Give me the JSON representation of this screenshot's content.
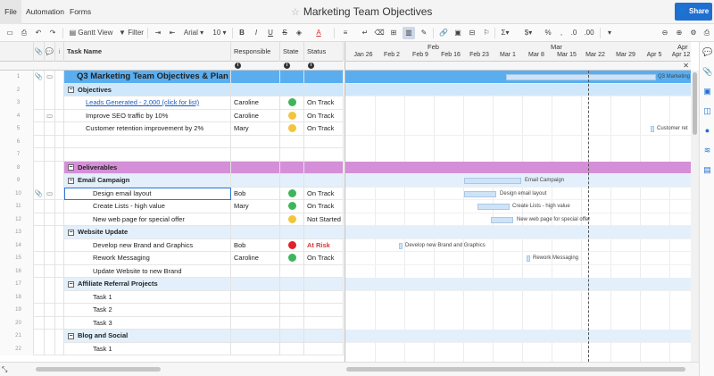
{
  "menu": {
    "file": "File",
    "automation": "Automation",
    "forms": "Forms"
  },
  "title": "Marketing Team Objectives",
  "share_label": "Share",
  "toolbar": {
    "view_label": "Gantt View",
    "filter_label": "Filter",
    "font": "Arial",
    "font_size": "10",
    "bold": "B",
    "italic": "I",
    "underline": "U",
    "strike": "S",
    "text_color": "A",
    "currency": "$",
    "percent": "%",
    "comma": ",",
    "decimal_less": ".0",
    "decimal_more": ".00",
    "sum": "Σ"
  },
  "columns": {
    "task": "Task Name",
    "responsible": "Responsible",
    "state": "State",
    "status": "Status"
  },
  "gantt": {
    "months": [
      "Feb",
      "Mar",
      "Apr"
    ],
    "weeks": [
      "Jan 26",
      "Feb 2",
      "Feb 9",
      "Feb 16",
      "Feb 23",
      "Mar 1",
      "Mar 8",
      "Mar 15",
      "Mar 22",
      "Mar 29",
      "Apr 5",
      "Apr 12"
    ],
    "bar_labels": {
      "row1": "Q3 Marketing",
      "row5": "Customer ret",
      "row9": "Email Campaign",
      "row10": "Design email layout",
      "row11": "Create Lists - high value",
      "row12": "New web page for special offer",
      "row14": "Develop new Brand and Graphics",
      "row15": "Rework Messaging"
    }
  },
  "rows": [
    {
      "num": "1",
      "task": "Q3 Marketing Team Objectives & Plan",
      "responsible": "",
      "status": ""
    },
    {
      "num": "2",
      "task": "Objectives",
      "responsible": "",
      "status": ""
    },
    {
      "num": "3",
      "task": "Leads Generated - 2,000 (click for list)",
      "responsible": "Caroline",
      "status": "On Track"
    },
    {
      "num": "4",
      "task": "Improve SEO traffic by 10%",
      "responsible": "Caroline",
      "status": "On Track"
    },
    {
      "num": "5",
      "task": "Customer retention improvement by 2%",
      "responsible": "Mary",
      "status": "On Track"
    },
    {
      "num": "6",
      "task": "",
      "responsible": "",
      "status": ""
    },
    {
      "num": "7",
      "task": "",
      "responsible": "",
      "status": ""
    },
    {
      "num": "8",
      "task": "Deliverables",
      "responsible": "",
      "status": ""
    },
    {
      "num": "9",
      "task": "Email Campaign",
      "responsible": "",
      "status": ""
    },
    {
      "num": "10",
      "task": "Design email layout",
      "responsible": "Bob",
      "status": "On Track"
    },
    {
      "num": "11",
      "task": "Create Lists - high value",
      "responsible": "Mary",
      "status": "On Track"
    },
    {
      "num": "12",
      "task": "New web page for special offer",
      "responsible": "",
      "status": "Not Started"
    },
    {
      "num": "13",
      "task": "Website Update",
      "responsible": "",
      "status": ""
    },
    {
      "num": "14",
      "task": "Develop new Brand and Graphics",
      "responsible": "Bob",
      "status": "At Risk"
    },
    {
      "num": "15",
      "task": "Rework Messaging",
      "responsible": "Caroline",
      "status": "On Track"
    },
    {
      "num": "16",
      "task": "Update Website to new Brand",
      "responsible": "",
      "status": ""
    },
    {
      "num": "17",
      "task": "Affiliate Referral Projects",
      "responsible": "",
      "status": ""
    },
    {
      "num": "18",
      "task": "Task 1",
      "responsible": "",
      "status": ""
    },
    {
      "num": "19",
      "task": "Task 2",
      "responsible": "",
      "status": ""
    },
    {
      "num": "20",
      "task": "Task 3",
      "responsible": "",
      "status": ""
    },
    {
      "num": "21",
      "task": "Blog and Social",
      "responsible": "",
      "status": ""
    },
    {
      "num": "22",
      "task": "Task 1",
      "responsible": "",
      "status": ""
    }
  ],
  "colors": {
    "accent": "#1f6fd1",
    "title_row": "#5aaef0",
    "section_blue": "#cfe7fa",
    "section_purple": "#d58fd8",
    "green": "#3fb55b",
    "yellow": "#f2c53d",
    "red": "#e0202a"
  }
}
